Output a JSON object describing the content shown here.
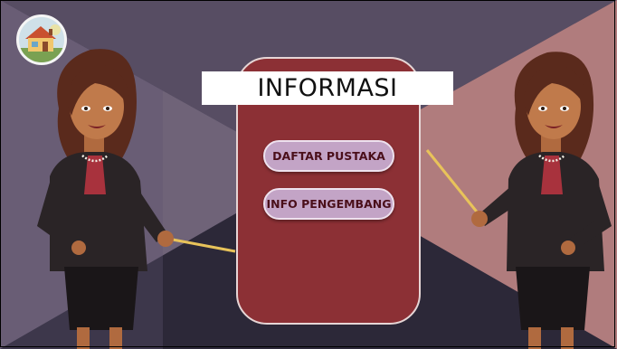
{
  "screen": {
    "title": "INFORMASI",
    "colors": {
      "panel": "#8c3035",
      "button": "#c3a4c6",
      "button_text": "#4a0f1a",
      "bg_left": "#4c4560",
      "bg_right": "#b27b7b"
    }
  },
  "home_button": {
    "icon": "home-icon"
  },
  "menu": {
    "items": [
      {
        "label": "DAFTAR PUSTAKA"
      },
      {
        "label": "INFO PENGEMBANG"
      }
    ]
  },
  "characters": [
    "presenter-left",
    "presenter-right"
  ]
}
